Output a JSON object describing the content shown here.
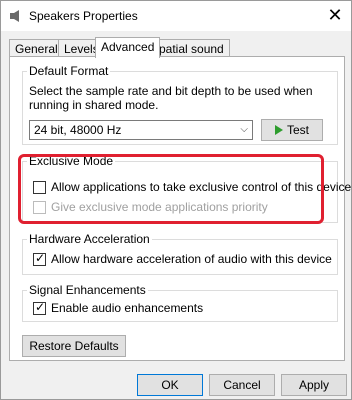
{
  "window": {
    "title": "Speakers Properties",
    "close_label": "✕"
  },
  "tabs": [
    {
      "label": "General",
      "active": false
    },
    {
      "label": "Levels",
      "active": false
    },
    {
      "label": "Advanced",
      "active": true
    },
    {
      "label": "Spatial sound",
      "active": false
    }
  ],
  "default_format": {
    "label": "Default Format",
    "description": "Select the sample rate and bit depth to be used when running in shared mode.",
    "selected_value": "24 bit, 48000 Hz",
    "test_label": "Test"
  },
  "exclusive_mode": {
    "label": "Exclusive Mode",
    "allow_exclusive": {
      "label": "Allow applications to take exclusive control of this device",
      "checked": false
    },
    "priority": {
      "label": "Give exclusive mode applications priority",
      "checked": false,
      "disabled": true
    }
  },
  "hardware_acceleration": {
    "label": "Hardware Acceleration",
    "allow_hw": {
      "label": "Allow hardware acceleration of audio with this device",
      "checked": true
    }
  },
  "signal_enhancements": {
    "label": "Signal Enhancements",
    "enable": {
      "label": "Enable audio enhancements",
      "checked": true
    }
  },
  "restore_defaults_label": "Restore Defaults",
  "footer": {
    "ok_label": "OK",
    "cancel_label": "Cancel",
    "apply_label": "Apply"
  },
  "colors": {
    "highlight": "#e02030",
    "accent": "#0078d7",
    "play": "#2e9d2e"
  }
}
